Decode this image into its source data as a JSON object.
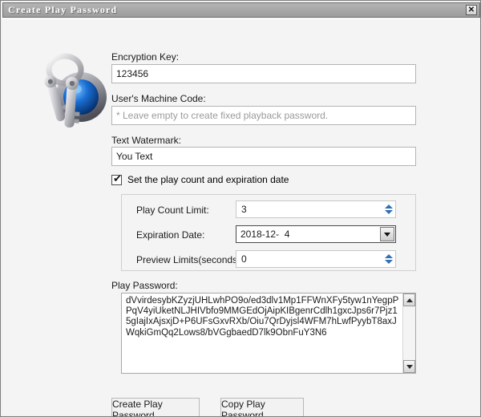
{
  "window": {
    "title": "Create Play Password",
    "close_label": "✕"
  },
  "icon": {
    "name": "keychain-icon"
  },
  "form": {
    "encryption_key": {
      "label": "Encryption Key:",
      "value": "123456"
    },
    "machine_code": {
      "label": "User's Machine Code:",
      "value": "",
      "placeholder": "* Leave empty to create fixed playback password."
    },
    "text_watermark": {
      "label": "Text Watermark:",
      "value": "You Text"
    },
    "set_limits_checkbox": {
      "label": "Set the play count and expiration date",
      "checked": true,
      "tick": "✔"
    },
    "play_count_limit": {
      "label": "Play Count Limit:",
      "value": "3"
    },
    "expiration_date": {
      "label": "Expiration Date:",
      "value": "2018-12-  4"
    },
    "preview_limits": {
      "label": "Preview Limits(seconds):",
      "value": "0"
    },
    "play_password": {
      "label": "Play Password:",
      "value": "dVvirdesybKZyzjUHLwhPO9o/ed3dlv1Mp1FFWnXFy5tyw1nYegpPPqV4yiUketNLJHIVbfo9MMGEdOjAipKIBgenrCdlh1gxcJps6r7Pjz15gIajIxAjsxjD+P6UFsGxvRXb/Oiu7QrDyjsl4WFM7hLwfPyybT8axJWqkiGmQq2Lows8/bVGgbaedD7lk9ObnFuY3N6"
    }
  },
  "buttons": {
    "create": "Create Play Password",
    "copy": "Copy Play Password"
  },
  "colors": {
    "accent_blue": "#2f6fb5",
    "titlebar_gray": "#a8a8a8",
    "dialog_bg": "#f4f4f4"
  }
}
